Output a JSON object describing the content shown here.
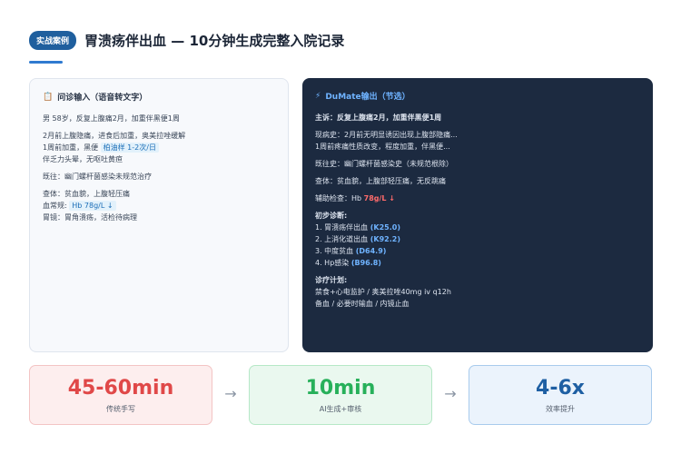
{
  "header": {
    "badge": "实战案例",
    "title": "胃溃疡伴出血 — 10分钟生成完整入院记录"
  },
  "left_card": {
    "icon": "clipboard-icon",
    "title": "问诊输入（语音转文字）",
    "chief": "男 58岁，反复上腹痛2月，加重伴黑便1周",
    "hist1": "2月前上腹隐痛，进食后加重，奥美拉唑缓解",
    "hist2_pre": "1周前加重，黑便 ",
    "hist2_hl": "柏油样 1-2次/日",
    "hist3": "伴乏力头晕，无呕吐黄疸",
    "past": "既往：幽门螺杆菌感染未规范治疗",
    "exam": "查体：贫血貌，上腹轻压痛",
    "lab_pre": "血常规: ",
    "lab_hl": "Hb 78g/L ↓",
    "endo": "胃镜：胃角溃疡，活检待病理"
  },
  "right_card": {
    "icon": "lightning-icon",
    "title": "DuMate输出（节选）",
    "chief": "主诉：反复上腹痛2月，加重伴黑便1周",
    "present1": "现病史：2月前无明显诱因出现上腹部隐痛...",
    "present2": "1周前疼痛性质改变，程度加重，伴黑便...",
    "past": "既往史：幽门螺杆菌感染史（未规范根除）",
    "exam": "查体：贫血貌，上腹部轻压痛，无反跳痛",
    "aux_pre": "辅助检查：Hb ",
    "aux_val": "78g/L ↓",
    "diag_title": "初步诊断:",
    "diagnoses": [
      {
        "text": "1. 胃溃疡伴出血 ",
        "code": "(K25.0)"
      },
      {
        "text": "2. 上消化道出血 ",
        "code": "(K92.2)"
      },
      {
        "text": "3. 中度贫血 ",
        "code": "(D64.9)"
      },
      {
        "text": "4. Hp感染 ",
        "code": "(B96.8)"
      }
    ],
    "plan_title": "诊疗计划:",
    "plan1": "禁食+心电监护 / 奥美拉唑40mg iv q12h",
    "plan2": "备血 / 必要时输血 / 内镜止血"
  },
  "metrics": [
    {
      "value": "45-60min",
      "label": "传统手写"
    },
    {
      "value": "10min",
      "label": "AI生成+审核"
    },
    {
      "value": "4-6x",
      "label": "效率提升"
    }
  ],
  "arrow_glyph": "→"
}
